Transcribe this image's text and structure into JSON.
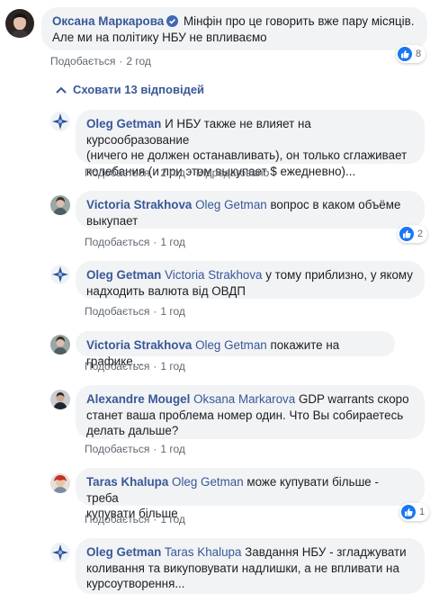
{
  "main_comment": {
    "author": "Оксана Маркарова",
    "text_line1": "Мінфін про це говорить вже пару місяців.",
    "text_line2": "Але ми на політику НБУ не впливаємо",
    "like_label": "Подобається",
    "time": "2 год",
    "reactions": "8"
  },
  "hide_replies_label": "Сховати 13 відповідей",
  "replies": [
    {
      "author": "Oleg Getman",
      "line1": "И НБУ также не влияет на курсообразование",
      "line2": "(ничего не должен останавливать), он только сглаживает",
      "line3": "колебания (и при этом выкупает $ ежедневно)...",
      "like_label": "Подобається",
      "time": "2 год",
      "edited": "Відредаговано"
    },
    {
      "author": "Victoria Strakhova",
      "mention": "Oleg Getman",
      "line1_rest": "вопрос в каком объёме",
      "line2": "выкупает",
      "like_label": "Подобається",
      "time": "1 год",
      "reactions": "2"
    },
    {
      "author": "Oleg Getman",
      "mention": "Victoria Strakhova",
      "line1_rest": "у тому приблизно, у якому",
      "line2": "надходить валюта від ОВДП",
      "like_label": "Подобається",
      "time": "1 год"
    },
    {
      "author": "Victoria Strakhova",
      "mention": "Oleg Getman",
      "line1_rest": "покажите на графике...",
      "like_label": "Подобається",
      "time": "1 год"
    },
    {
      "author": "Alexandre Mougel",
      "mention": "Oksana Markarova",
      "line1_rest": "GDP warrants скоро",
      "line2": "станет ваша проблема номер один. Что Вы собираетесь",
      "line3": "делать дальше?",
      "like_label": "Подобається",
      "time": "1 год"
    },
    {
      "author": "Taras Khalupa",
      "mention": "Oleg Getman",
      "line1_rest": "може купувати більше - треба",
      "line2": "купувати більше",
      "like_label": "Подобається",
      "time": "1 год",
      "reactions": "1"
    },
    {
      "author": "Oleg Getman",
      "mention": "Taras Khalupa",
      "line1_rest": "Завдання НБУ - згладжувати",
      "line2": "коливання та викуповувати надлишки, а не впливати на",
      "line3": "курсоутворення..."
    }
  ],
  "colors": {
    "link": "#385898",
    "bubble": "#f2f3f5",
    "meta": "#606770",
    "like_blue": "#1877f2"
  }
}
